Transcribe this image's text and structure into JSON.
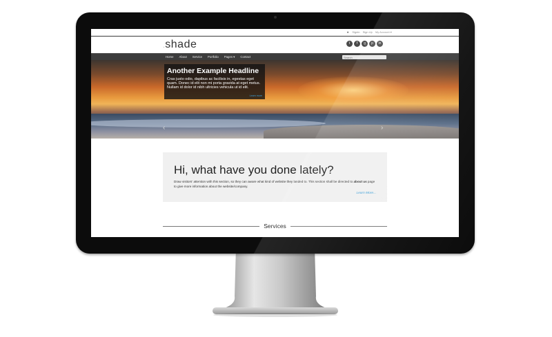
{
  "topbar": {
    "links": [
      "Signin",
      "Sign Up",
      "My Account ▾"
    ]
  },
  "brand": {
    "logo_dot": ".",
    "logo_text": "shade"
  },
  "social": [
    {
      "icon": "twitter-icon",
      "glyph": "t"
    },
    {
      "icon": "facebook-icon",
      "glyph": "f"
    },
    {
      "icon": "google-plus-icon",
      "glyph": "g"
    },
    {
      "icon": "pinterest-icon",
      "glyph": "p"
    },
    {
      "icon": "linkedin-icon",
      "glyph": "in"
    }
  ],
  "nav": {
    "items": [
      "Home",
      "About",
      "Service",
      "Portfolio",
      "Pages ▾",
      "Contact"
    ],
    "search_placeholder": "Search"
  },
  "hero": {
    "headline": "Another Example Headline",
    "body": "Cras justo odio, dapibus ac facilisis in, egestas eget quam. Donec id elit non mi porta gravida at eget metus. Nullam id dolor id nibh ultricies vehicula ut id elit.",
    "learn_more": "Learn more",
    "prev_arrow": "‹",
    "next_arrow": "›"
  },
  "cta": {
    "heading": "Hi, what have you done lately?",
    "body_before": "Draw visitors' attention with this section, so they can aware what kind of website they landed to. This section shall be directed to ",
    "body_bold": "about us",
    "body_after": " page to give more information about the website/company.",
    "link": "Learn More..."
  },
  "services": {
    "title": "Services"
  },
  "colors": {
    "nav_bg": "#3c3c3c",
    "link": "#3b9fd8",
    "cta_bg": "#f0f0f0",
    "bezel": "#0c0c0c"
  }
}
